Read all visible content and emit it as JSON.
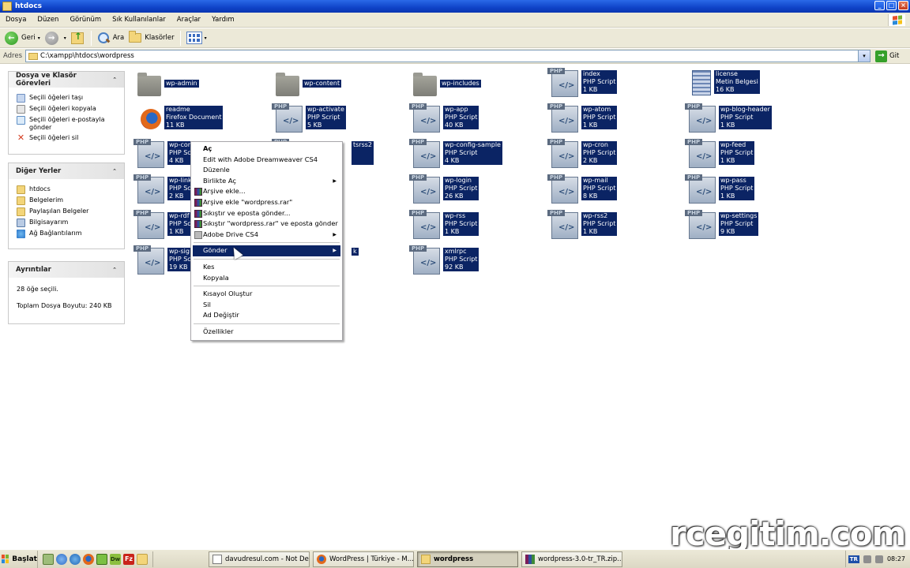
{
  "window": {
    "title": "htdocs",
    "caption_buttons": [
      "_",
      "□",
      "×"
    ]
  },
  "menu": [
    "Dosya",
    "Düzen",
    "Görünüm",
    "Sık Kullanılanlar",
    "Araçlar",
    "Yardım"
  ],
  "toolbar": {
    "back_label": "Geri",
    "forward_label": "",
    "search_label": "Ara",
    "folders_label": "Klasörler",
    "dropdown_glyph": "▾"
  },
  "address": {
    "label": "Adres",
    "path": "C:\\xampp\\htdocs\\wordpress",
    "go_label": "Git"
  },
  "tasks_panel": {
    "title": "Dosya ve Klasör Görevleri",
    "collapse_glyph": "⌃",
    "items": [
      "Seçili öğeleri taşı",
      "Seçili öğeleri kopyala",
      "Seçili öğeleri e-postayla gönder",
      "Seçili öğeleri sil"
    ]
  },
  "places_panel": {
    "title": "Diğer Yerler",
    "items": [
      "htdocs",
      "Belgelerim",
      "Paylaşılan Belgeler",
      "Bilgisayarım",
      "Ağ Bağlantılarım"
    ]
  },
  "details_panel": {
    "title": "Ayrıntılar",
    "selected_count": "28 öğe seçili.",
    "total_size": "Toplam Dosya Boyutu: 240 KB"
  },
  "files": [
    {
      "name": "wp-admin",
      "type": "",
      "size": "",
      "icon": "folder"
    },
    {
      "name": "wp-content",
      "type": "",
      "size": "",
      "icon": "folder"
    },
    {
      "name": "wp-includes",
      "type": "",
      "size": "",
      "icon": "folder"
    },
    {
      "name": "index",
      "type": "PHP Script",
      "size": "1 KB",
      "icon": "php"
    },
    {
      "name": "license",
      "type": "Metin Belgesi",
      "size": "16 KB",
      "icon": "text"
    },
    {
      "name": "readme",
      "type": "Firefox Document",
      "size": "11 KB",
      "icon": "firefox"
    },
    {
      "name": "wp-activate",
      "type": "PHP Script",
      "size": "5 KB",
      "icon": "php"
    },
    {
      "name": "wp-app",
      "type": "PHP Script",
      "size": "40 KB",
      "icon": "php"
    },
    {
      "name": "wp-atom",
      "type": "PHP Script",
      "size": "1 KB",
      "icon": "php"
    },
    {
      "name": "wp-blog-header",
      "type": "PHP Script",
      "size": "1 KB",
      "icon": "php"
    },
    {
      "name": "wp-com",
      "type": "PHP Sc",
      "size": "4 KB",
      "icon": "php"
    },
    {
      "name": "",
      "type": "",
      "size": "",
      "icon": "php"
    },
    {
      "name": "wp-config-sample",
      "type": "PHP Script",
      "size": "4 KB",
      "icon": "php"
    },
    {
      "name": "wp-cron",
      "type": "PHP Script",
      "size": "2 KB",
      "icon": "php"
    },
    {
      "name": "wp-feed",
      "type": "PHP Script",
      "size": "1 KB",
      "icon": "php"
    },
    {
      "name": "wp-link",
      "type": "PHP Sc",
      "size": "2 KB",
      "icon": "php"
    },
    {
      "name": "wp-login",
      "type": "PHP Script",
      "size": "26 KB",
      "icon": "php"
    },
    {
      "name": "wp-mail",
      "type": "PHP Script",
      "size": "8 KB",
      "icon": "php"
    },
    {
      "name": "wp-pass",
      "type": "PHP Script",
      "size": "1 KB",
      "icon": "php"
    },
    {
      "name": "wp-rdf",
      "type": "PHP Sc",
      "size": "1 KB",
      "icon": "php"
    },
    {
      "name": "wp-rss",
      "type": "PHP Script",
      "size": "1 KB",
      "icon": "php"
    },
    {
      "name": "wp-rss2",
      "type": "PHP Script",
      "size": "1 KB",
      "icon": "php"
    },
    {
      "name": "wp-settings",
      "type": "PHP Script",
      "size": "9 KB",
      "icon": "php"
    },
    {
      "name": "wp-sig",
      "type": "PHP Sc",
      "size": "19 KB",
      "icon": "php"
    },
    {
      "name": "xmlrpc",
      "type": "PHP Script",
      "size": "92 KB",
      "icon": "php"
    }
  ],
  "partial_labels": {
    "rss2_fragment": "tsrss2",
    "k_fragment": "k"
  },
  "context_menu": {
    "items": [
      {
        "label": "Aç",
        "bold": true
      },
      {
        "label": "Edit with Adobe Dreamweaver CS4"
      },
      {
        "label": "Düzenle"
      },
      {
        "label": "Birlikte Aç",
        "submenu": true
      },
      {
        "label": "Arşive ekle...",
        "icon": "winrar"
      },
      {
        "label": "Arşive ekle \"wordpress.rar\"",
        "icon": "winrar"
      },
      {
        "label": "Sıkıştır ve eposta gönder...",
        "icon": "winrar"
      },
      {
        "label": "Sıkıştır \"wordpress.rar\" ve eposta gönder",
        "icon": "winrar"
      },
      {
        "label": "Adobe Drive CS4",
        "icon": "adobe",
        "submenu": true
      },
      {
        "separator": true
      },
      {
        "label": "Gönder",
        "submenu": true,
        "selected": true
      },
      {
        "separator": true
      },
      {
        "label": "Kes"
      },
      {
        "label": "Kopyala"
      },
      {
        "separator": true
      },
      {
        "label": "Kısayol Oluştur"
      },
      {
        "label": "Sil"
      },
      {
        "label": "Ad Değiştir"
      },
      {
        "separator": true
      },
      {
        "label": "Özellikler"
      }
    ],
    "submenu_arrow": "▶"
  },
  "watermark": "rcegitim.com",
  "taskbar": {
    "start_label": "Başlat",
    "tasks": [
      {
        "label": "davudresul.com - Not De...",
        "icon": "notepad"
      },
      {
        "label": "WordPress | Türkiye - M...",
        "icon": "firefox"
      },
      {
        "label": "wordpress",
        "icon": "folder",
        "active": true
      },
      {
        "label": "wordpress-3.0-tr_TR.zip...",
        "icon": "winrar"
      }
    ],
    "tray_lang": "TR",
    "clock": "08:27"
  }
}
